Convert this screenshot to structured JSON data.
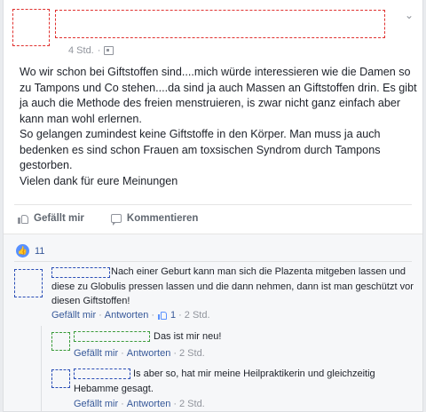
{
  "post": {
    "timestamp": "4 Std.",
    "audience_icon": "audience-icon",
    "body_lines": [
      "Wo wir schon bei Giftstoffen sind....mich würde interessieren wie die Damen so zu Tampons und Co stehen....da sind ja auch Massen an Giftstoffen drin. Es gibt ja auch die Methode des freien menstruieren, is zwar nicht ganz einfach aber kann man wohl erlernen.",
      "So gelangen zumindest keine Giftstoffe in den Körper. Man muss ja auch bedenken es sind schon Frauen am toxsischen Syndrom durch Tampons gestorben.",
      "Vielen dank für eure Meinungen"
    ]
  },
  "actions": {
    "like": "Gefällt mir",
    "comment": "Kommentieren"
  },
  "reactions": {
    "count": "11"
  },
  "comments": [
    {
      "text": "Nach einer Geburt kann man sich die Plazenta mitgeben lassen und diese zu Globulis pressen lassen und die dann nehmen, dann ist man geschützt vor diesen Giftstoffen!",
      "like": "Gefällt mir",
      "reply": "Antworten",
      "likes": "1",
      "time": "2 Std."
    }
  ],
  "replies": [
    {
      "text": "Das ist mir neu!",
      "like": "Gefällt mir",
      "reply": "Antworten",
      "time": "2 Std."
    },
    {
      "text": "Is aber so, hat mir meine Heilpraktikerin und gleichzeitig Hebamme gesagt.",
      "like": "Gefällt mir",
      "reply": "Antworten",
      "time": "2 Std."
    }
  ],
  "separator": "·",
  "colors": {
    "link": "#365899",
    "meta": "#90949c",
    "redaction_post": "#e0312f",
    "redaction_comment": "#2a4eb6",
    "redaction_reply_avatar": "#3a9b3a"
  }
}
